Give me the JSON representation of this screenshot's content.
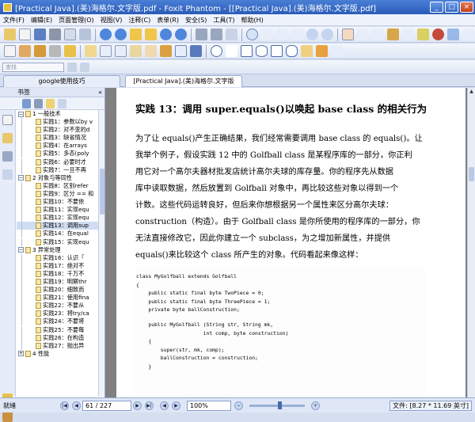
{
  "window": {
    "title": "[Practical Java].(美)海格尔.文字版.pdf - Foxit Phantom - [[Practical Java].(美)海格尔.文字版.pdf]"
  },
  "menu": [
    "文件(F)",
    "编辑(E)",
    "页面管理(O)",
    "视图(V)",
    "注释(C)",
    "表单(R)",
    "安全(S)",
    "工具(T)",
    "帮助(H)"
  ],
  "toolbar": {
    "search_placeholder": "查找"
  },
  "tabs": [
    {
      "label": "google使用技巧"
    },
    {
      "label": "[Practical Java].(美)海格尔.文字版"
    }
  ],
  "bookmarks": {
    "title": "书签",
    "collapse": "«",
    "items": [
      {
        "label": "1 一般技术",
        "type": "section",
        "toggle": "−"
      },
      {
        "label": "实践1：参数以by v",
        "type": "child"
      },
      {
        "label": "实践2：对不变的d",
        "type": "child"
      },
      {
        "label": "实践3：缺省情况",
        "type": "child"
      },
      {
        "label": "实践4：在arrays",
        "type": "child"
      },
      {
        "label": "实践5：多态(poly",
        "type": "child"
      },
      {
        "label": "实践6：必要时才",
        "type": "child"
      },
      {
        "label": "实践7：一旦不再",
        "type": "child"
      },
      {
        "label": "2 对象与等同性",
        "type": "section",
        "toggle": "−"
      },
      {
        "label": "实践8：区别refer",
        "type": "child"
      },
      {
        "label": "实践9：区分 == 和",
        "type": "child"
      },
      {
        "label": "实践10：不要依",
        "type": "child"
      },
      {
        "label": "实践11：实现equ",
        "type": "child"
      },
      {
        "label": "实践12：实现equ",
        "type": "child"
      },
      {
        "label": "实践13：调用sup",
        "type": "child",
        "selected": true
      },
      {
        "label": "实践14：在equal",
        "type": "child"
      },
      {
        "label": "实践15：实现equ",
        "type": "child"
      },
      {
        "label": "3 异常处理",
        "type": "section",
        "toggle": "−"
      },
      {
        "label": "实践16：认识「",
        "type": "child"
      },
      {
        "label": "实践17：绝对不",
        "type": "child"
      },
      {
        "label": "实践18：千万不",
        "type": "child"
      },
      {
        "label": "实践19：明察thr",
        "type": "child"
      },
      {
        "label": "实践20：细致而",
        "type": "child"
      },
      {
        "label": "实践21：使用fina",
        "type": "child"
      },
      {
        "label": "实践22：不要从",
        "type": "child"
      },
      {
        "label": "实践23：将try/ca",
        "type": "child"
      },
      {
        "label": "实践24：不要将",
        "type": "child"
      },
      {
        "label": "实践25：不要每",
        "type": "child"
      },
      {
        "label": "实践26：在构造",
        "type": "child"
      },
      {
        "label": "实践27：抛出异",
        "type": "child"
      },
      {
        "label": "4 性能",
        "type": "section",
        "toggle": "+"
      }
    ]
  },
  "document": {
    "heading": "实践 13：调用 super.equals()以唤起 base class 的相关行为",
    "paragraph_lines": [
      "为了让 equals()产生正确结果，我们经常需要调用 base class 的 equals()。让",
      "我举个例子，假设实践 12 中的 Golfball class 是某程序库的一部分，你正利",
      "用它对一个高尔夫器材批发店统计高尔夫球的库存量。你的程序先从数据",
      "库中读取数据，然后放置到 Golfball 对象中，再比较这些对象以得到一个",
      "计数。这些代码运转良好，但后来你想根据另一个属性来区分高尔夫球：",
      "construction（构造）。由于 Golfball class 是你所使用的程序库的一部分，你",
      "无法直接修改它，因此你建立一个 subclass，为之增加新属性，并提供",
      "equals()来比较这个 class 所产生的对象。代码看起来像这样："
    ],
    "code_lines": [
      "class MyGolfball extends Golfball",
      "{",
      "    public static final byte TwoPiece = 0;",
      "    public static final byte ThreePiece = 1;",
      "    private byte ballConstruction;",
      "",
      "    public MyGolfball (String str, String mk,",
      "                      int comp, byte construction)",
      "    {",
      "        super(str, mk, comp);",
      "        ballConstruction = construction;",
      "    }"
    ]
  },
  "status": {
    "left": "就绪",
    "page": "61 / 227",
    "zoom": "100%",
    "doc_size": "文件: [8.27 * 11.69 英寸]"
  }
}
